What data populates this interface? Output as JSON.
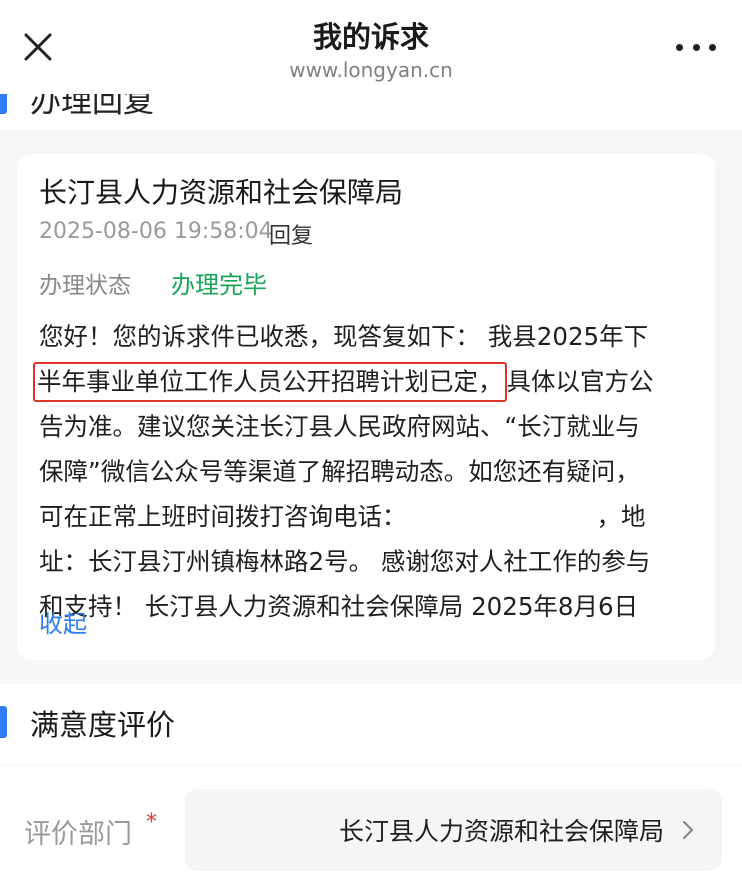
{
  "navbar": {
    "title": "我的诉求",
    "url": "www.longyan.cn"
  },
  "under_section": {
    "title": "办理回复"
  },
  "reply": {
    "department": "长汀县人力资源和社会保障局",
    "time": "2025-08-06 19:58:04",
    "tag": "回复",
    "status_label": "办理状态",
    "status_value": "办理完毕",
    "lines": [
      "您好！您的诉求件已收悉，现答复如下： 我县2025年下",
      "半年事业单位工作人员公开招聘计划已定，",
      "具体以官方公",
      "告为准。建议您关注长汀县人民政府网站、“长汀就业与",
      "保障”微信公众号等渠道了解招聘动态。如您还有疑问，",
      "可在正常上班时间拨打咨询电话：",
      "，地",
      "址：长汀县汀州镇梅林路2号。 感谢您对人社工作的参与",
      "和支持！ 长汀县人力资源和社会保障局 2025年8月6日"
    ],
    "collapse_label": "收起"
  },
  "satisfaction": {
    "title": "满意度评价",
    "field_label": "评价部门",
    "required_mark": "*",
    "selected_value": "长汀县人力资源和社会保障局"
  },
  "colors": {
    "accent_blue": "#2f7df6",
    "status_green": "#18a558",
    "highlight_red": "#e0352b"
  },
  "icons": {
    "close": "close-icon",
    "more": "more-dots-icon",
    "chevron": "chevron-right-icon"
  }
}
